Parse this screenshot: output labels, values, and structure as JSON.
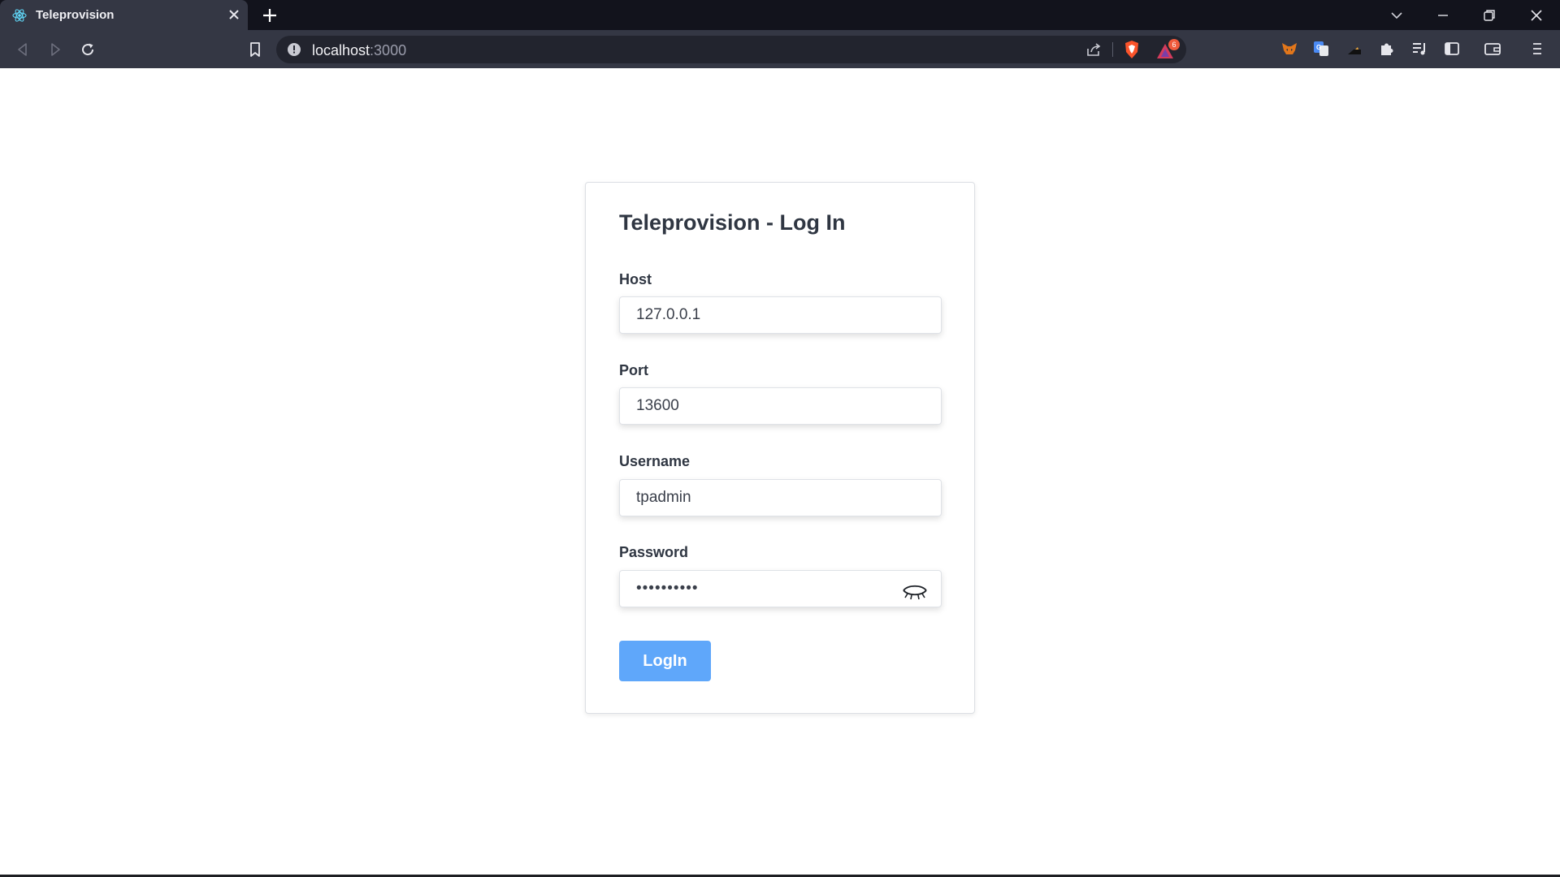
{
  "browser": {
    "tab_title": "Teleprovision",
    "url_host": "localhost",
    "url_port": ":3000",
    "notification_badge": "6"
  },
  "login": {
    "title": "Teleprovision - Log In",
    "host_label": "Host",
    "host_value": "127.0.0.1",
    "port_label": "Port",
    "port_value": "13600",
    "username_label": "Username",
    "username_value": "tpadmin",
    "password_label": "Password",
    "password_value": "••••••••••",
    "submit_label": "LogIn"
  },
  "colors": {
    "accent": "#5fa7fa",
    "chrome_dark": "#12131c",
    "chrome_toolbar": "#343744"
  }
}
